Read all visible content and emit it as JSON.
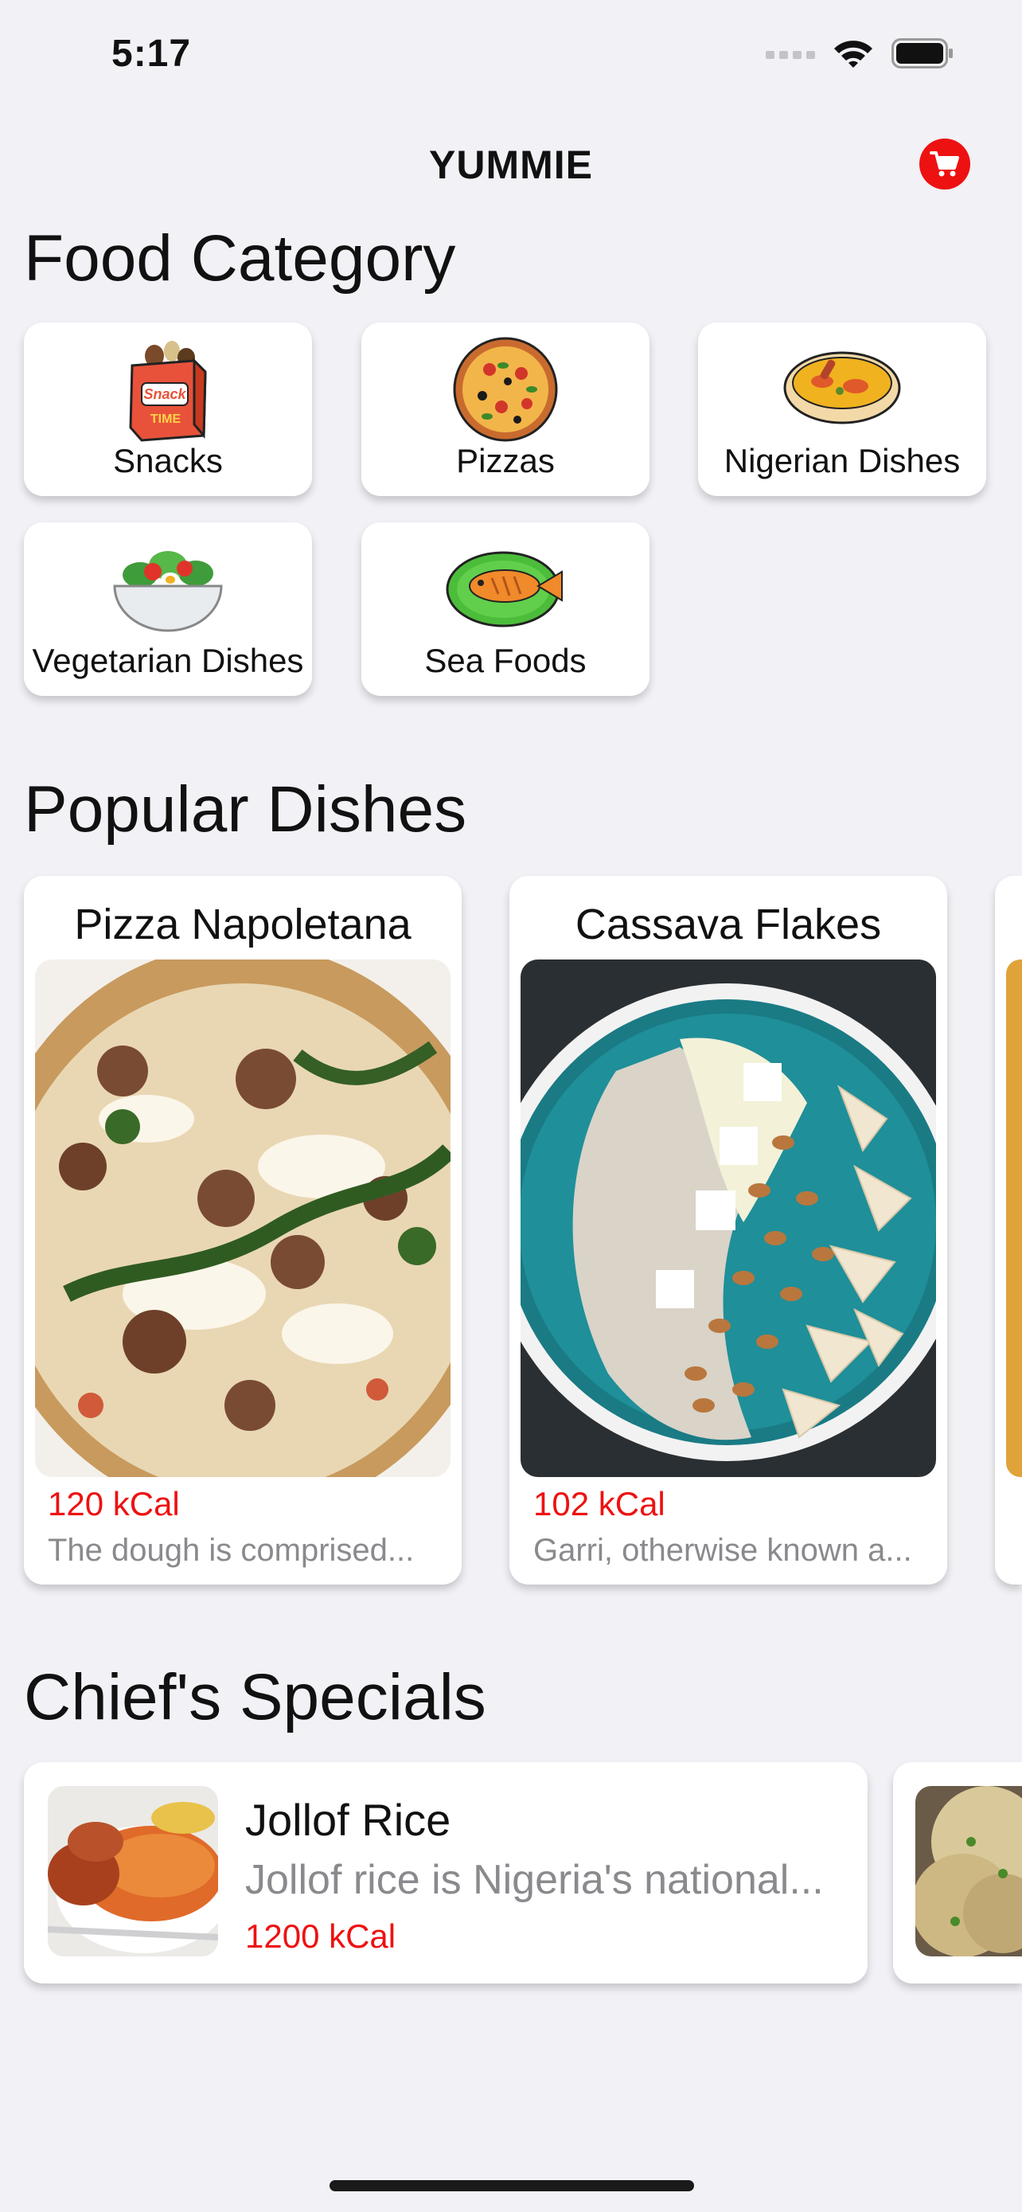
{
  "status": {
    "time": "5:17"
  },
  "nav": {
    "title": "YUMMIE",
    "cart_icon": "cart-icon"
  },
  "food_category": {
    "title": "Food Category",
    "items": [
      {
        "label": "Snacks",
        "icon": "snack-box-icon"
      },
      {
        "label": "Pizzas",
        "icon": "pizza-icon"
      },
      {
        "label": "Nigerian Dishes",
        "icon": "soup-bowl-icon"
      },
      {
        "label": "Vegetarian Dishes",
        "icon": "salad-bowl-icon"
      },
      {
        "label": "Sea Foods",
        "icon": "fish-plate-icon"
      }
    ]
  },
  "popular_dishes": {
    "title": "Popular Dishes",
    "items": [
      {
        "name": "Pizza Napoletana",
        "kcal": "120 kCal",
        "description": "The dough is comprised..."
      },
      {
        "name": "Cassava Flakes",
        "kcal": "102 kCal",
        "description": "Garri, otherwise known a..."
      }
    ]
  },
  "chiefs_specials": {
    "title": "Chief's Specials",
    "items": [
      {
        "name": "Jollof Rice",
        "description": "Jollof rice is Nigeria's national...",
        "kcal": "1200 kCal"
      }
    ]
  },
  "colors": {
    "accent": "#ee1111",
    "background": "#f2f1f6",
    "card": "#ffffff",
    "secondary_text": "#8a8a8e"
  }
}
